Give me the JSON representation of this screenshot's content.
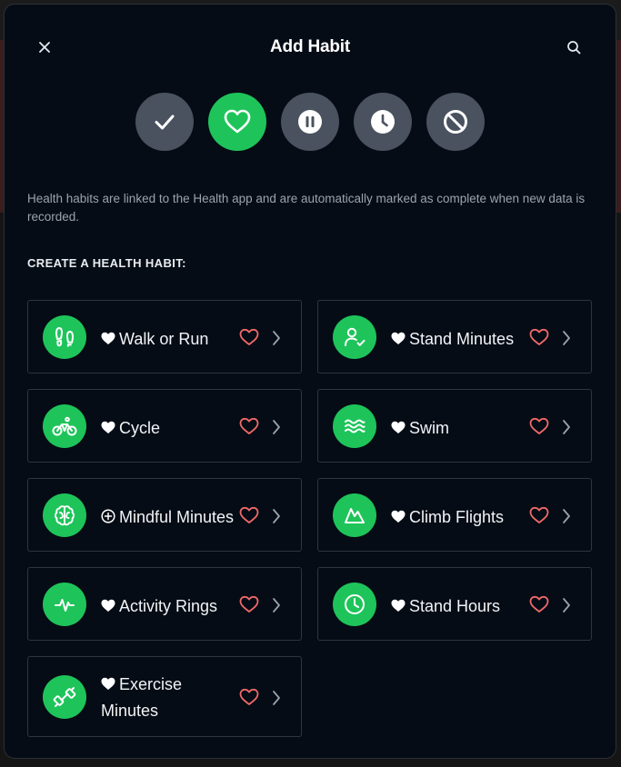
{
  "header": {
    "title": "Add Habit"
  },
  "habit_types": [
    {
      "name": "check-icon",
      "active": false
    },
    {
      "name": "heart-icon",
      "active": true
    },
    {
      "name": "pause-icon",
      "active": false
    },
    {
      "name": "clock-icon",
      "active": false
    },
    {
      "name": "block-icon",
      "active": false
    }
  ],
  "description": "Health habits are linked to the Health app and are automatically marked as complete when new data is recorded.",
  "section_title": "CREATE A HEALTH HABIT:",
  "colors": {
    "accent_green": "#1ec45a",
    "favorite_red": "#f06a6a",
    "modal_bg": "#060c15"
  },
  "habits": [
    {
      "label": "Walk or Run",
      "icon": "footprints-icon",
      "lead": "heart"
    },
    {
      "label": "Stand Minutes",
      "icon": "person-check-icon",
      "lead": "heart"
    },
    {
      "label": "Cycle",
      "icon": "bicycle-icon",
      "lead": "heart"
    },
    {
      "label": "Swim",
      "icon": "waves-icon",
      "lead": "heart"
    },
    {
      "label": "Mindful Minutes",
      "icon": "brain-icon",
      "lead": "plus-circle"
    },
    {
      "label": "Climb Flights",
      "icon": "mountain-icon",
      "lead": "heart"
    },
    {
      "label": "Activity Rings",
      "icon": "activity-icon",
      "lead": "heart"
    },
    {
      "label": "Stand Hours",
      "icon": "clock-icon",
      "lead": "heart"
    },
    {
      "label": "Exercise Minutes",
      "icon": "dumbbell-icon",
      "lead": "heart"
    }
  ]
}
